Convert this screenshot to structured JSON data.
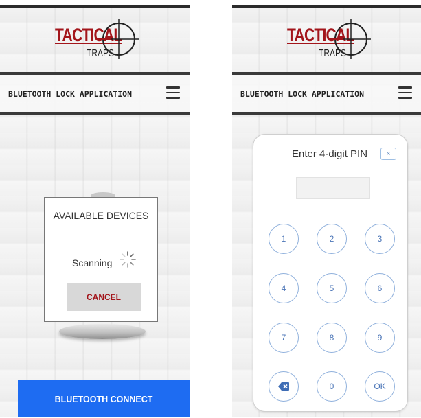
{
  "left_screen": {
    "logo": {
      "line1": "TACTICAL",
      "line2": "TRAPS"
    },
    "header": {
      "title": "BLUETOOTH LOCK APPLICATION"
    },
    "devices_dialog": {
      "title": "AVAILABLE DEVICES",
      "status": "Scanning",
      "cancel_label": "CANCEL"
    },
    "connect_label": "BLUETOOTH CONNECT"
  },
  "right_screen": {
    "logo": {
      "line1": "TACTICAL",
      "line2": "TRAPS"
    },
    "header": {
      "title": "BLUETOOTH LOCK APPLICATION"
    },
    "pin_dialog": {
      "title": "Enter 4-digit PIN",
      "close_label": "×",
      "pin_value": "",
      "keys": [
        "1",
        "2",
        "3",
        "4",
        "5",
        "6",
        "7",
        "8",
        "9",
        "",
        "0",
        "OK"
      ]
    }
  },
  "colors": {
    "brand_red": "#a3151b",
    "connect_blue": "#1e6cf2",
    "key_blue": "#4b75b7"
  },
  "icons": [
    "crosshair-icon",
    "hamburger-menu-icon",
    "loading-spinner-icon",
    "backspace-icon",
    "close-icon"
  ]
}
